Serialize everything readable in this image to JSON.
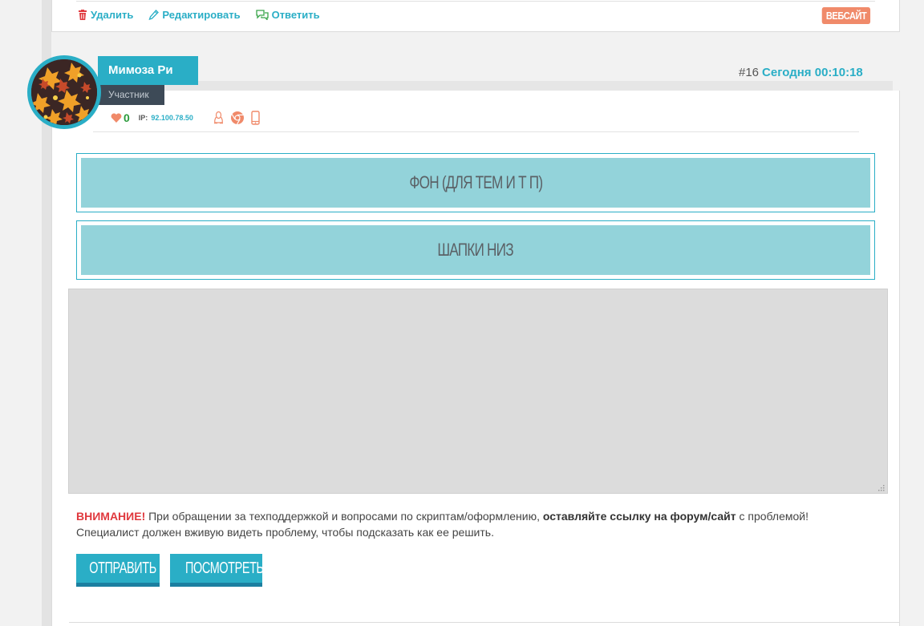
{
  "previous_post": {
    "actions": [
      {
        "label": "Удалить",
        "icon": "trash-icon",
        "color": "#e0393e"
      },
      {
        "label": "Редактировать",
        "icon": "pencil-icon",
        "color": "#2aaec6"
      },
      {
        "label": "Ответить",
        "icon": "chat-icon",
        "color": "#3aa54a"
      }
    ],
    "website_badge": "ВЕБСАЙТ"
  },
  "post": {
    "username": "Мимоза Ри",
    "role": "Участник",
    "number": "#16",
    "date": "Сегодня 00:10:18",
    "likes": "0",
    "ip_label": "IP:",
    "ip": "92.100.78.50",
    "client_icons": [
      "linux-icon",
      "chrome-icon",
      "mobile-icon"
    ]
  },
  "categories": [
    {
      "label": "ФОН (ДЛЯ ТЕМ И Т П)"
    },
    {
      "label": "ШАПКИ НИЗ"
    }
  ],
  "reply": {
    "textarea_value": "",
    "notice_warning": "ВНИМАНИЕ!",
    "notice_text_1": " При обращении за техподдержкой и вопросами по скриптам/оформлению, ",
    "notice_bold": "оставляйте ссылку на форум/сайт",
    "notice_text_2": " с проблемой! Специалист должен вживую видеть проблему, чтобы подсказать как ее решить.",
    "send_label": "ОТПРАВИТЬ",
    "preview_label": "ПОСМОТРЕТЬ"
  },
  "colors": {
    "accent": "#2aaec6",
    "accent_dark": "#1c7fa0",
    "category_fill": "#93d3da",
    "warning": "#e0393e",
    "badge": "#f08a6a",
    "role_bg": "#3d4a57"
  }
}
